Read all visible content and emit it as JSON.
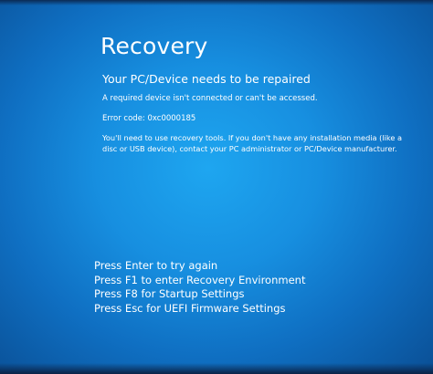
{
  "screen": {
    "background_color": "#178fe0",
    "text_color": "#ffffff"
  },
  "recovery": {
    "title": "Recovery",
    "subtitle": "Your PC/Device needs to be repaired",
    "description": "A required device isn't connected or can't be accessed.",
    "error_code": "Error code: 0xc0000185",
    "tools_message": "You'll need to use recovery tools. If you don't have any installation media (like a disc or USB device), contact your PC administrator or PC/Device manufacturer."
  },
  "options": [
    {
      "label": "Press Enter to try again"
    },
    {
      "label": "Press F1 to enter Recovery Environment"
    },
    {
      "label": "Press F8 for Startup Settings"
    },
    {
      "label": "Press Esc for UEFI Firmware Settings"
    }
  ]
}
